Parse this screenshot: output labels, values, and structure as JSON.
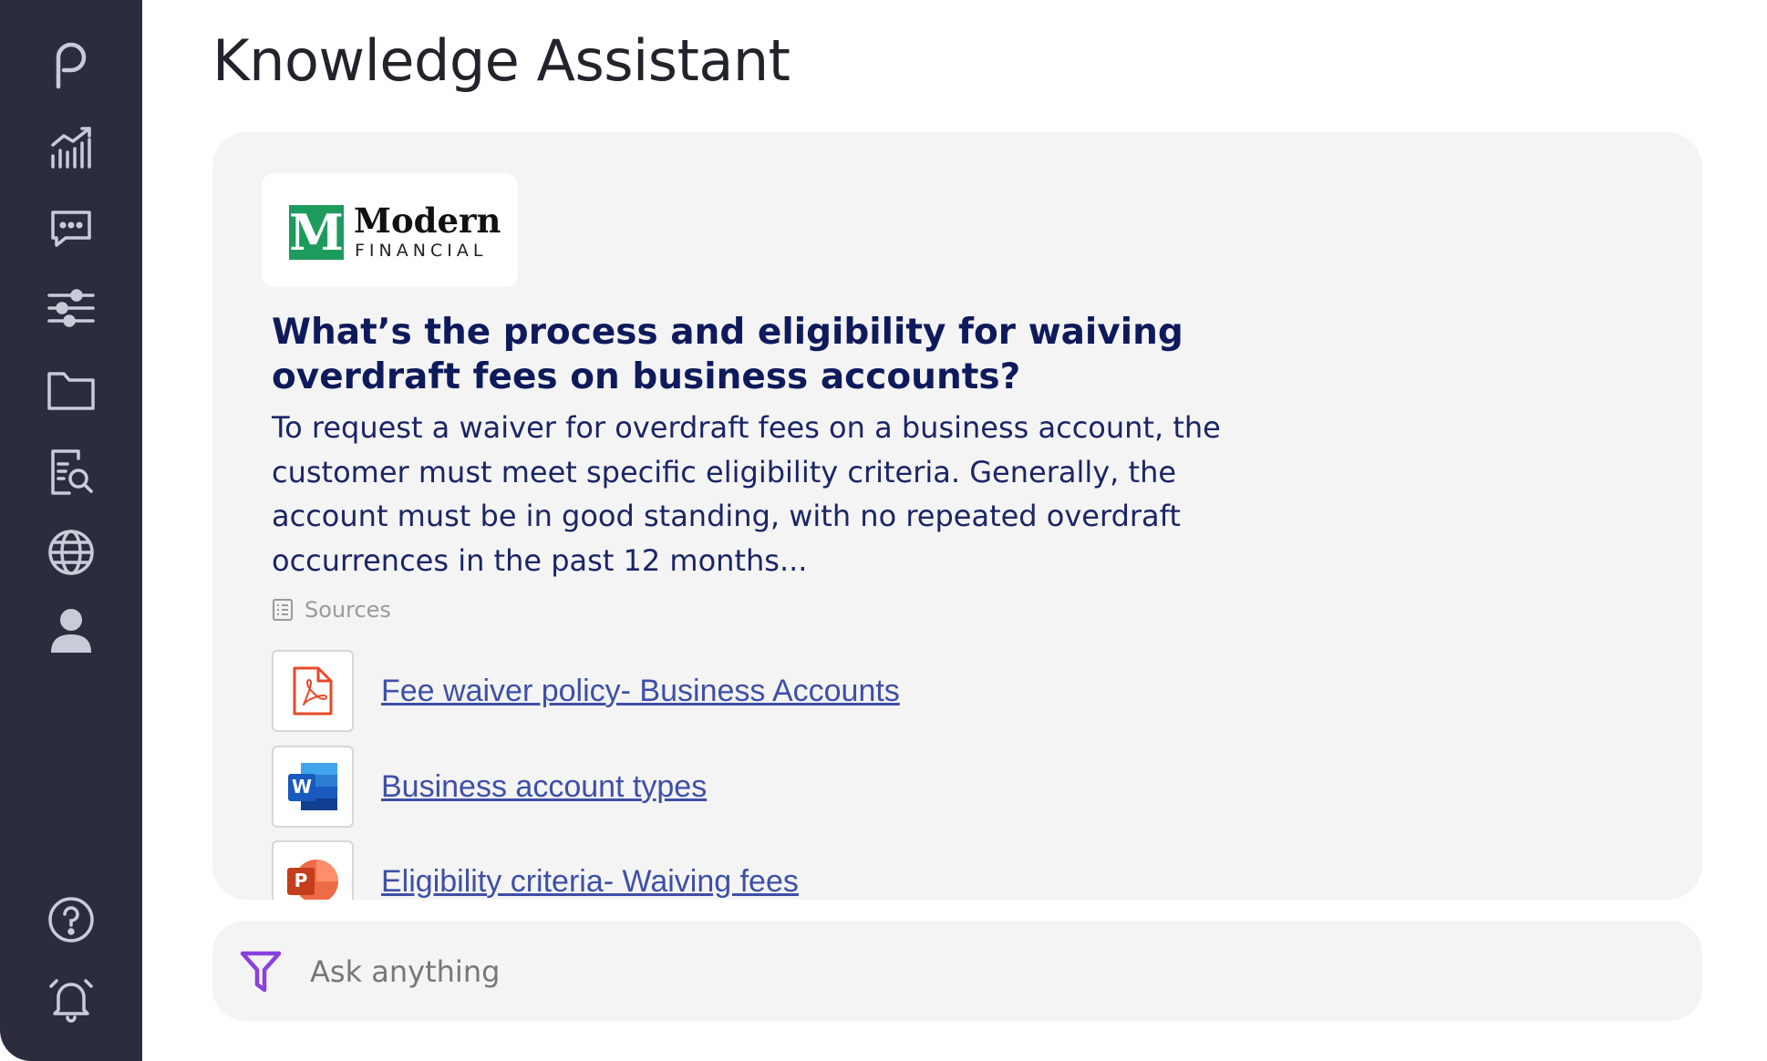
{
  "app": {
    "title": "Knowledge Assistant"
  },
  "sidebar": {
    "items": [
      {
        "icon": "logo-icon",
        "label": ""
      },
      {
        "icon": "analytics-icon",
        "label": ""
      },
      {
        "icon": "chat-icon",
        "label": ""
      },
      {
        "icon": "sliders-icon",
        "label": ""
      },
      {
        "icon": "folder-icon",
        "label": ""
      },
      {
        "icon": "document-search-icon",
        "label": ""
      },
      {
        "icon": "globe-icon",
        "label": ""
      },
      {
        "icon": "user-icon",
        "label": ""
      },
      {
        "icon": "help-icon",
        "label": ""
      },
      {
        "icon": "bell-icon",
        "label": ""
      }
    ],
    "colors": {
      "background": "#2b2d3f",
      "icon": "#c9ccd8"
    }
  },
  "card": {
    "logo": {
      "mark": "M",
      "name": "Modern",
      "subtitle": "FINANCIAL"
    },
    "question": "What’s the process and eligibility for waiving overdraft fees on business accounts?",
    "answer": "To request a waiver for overdraft fees on a business account, the customer must meet specific eligibility criteria. Generally, the account must be in good standing, with no repeated overdraft occurrences in the past 12 months...",
    "sources_label": "Sources",
    "sources": [
      {
        "type": "pdf",
        "title": "Fee waiver policy- Business Accounts"
      },
      {
        "type": "word",
        "title": "Business account types"
      },
      {
        "type": "powerpoint",
        "title": "Eligibility criteria- Waiving fees"
      }
    ]
  },
  "ask": {
    "placeholder": "Ask anything",
    "accent": "#8a3fe0"
  }
}
